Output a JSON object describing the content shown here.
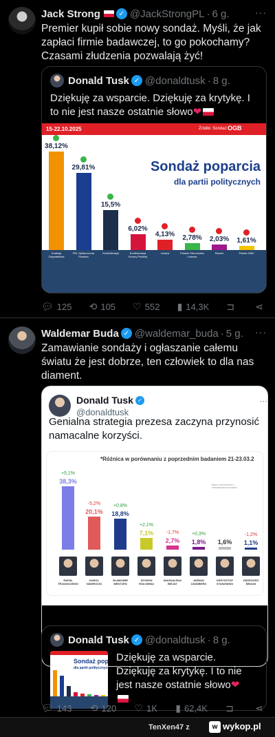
{
  "tweet1": {
    "name": "Jack Strong",
    "handle": "@JackStrongPL",
    "time": "6 g.",
    "more": "···",
    "text": "Premier kupił sobie nowy sondaż. Myśli, że jak zapłaci firmie badawczej, to go pokochamy? Czasami złudzenia pozwalają żyć!",
    "quote": {
      "name": "Donald Tusk",
      "handle": "@donaldtusk",
      "time": "8 g.",
      "text": "Dziękuję za wsparcie. Dziękuję za krytykę. I to nie jest nasze ostatnie słowo"
    },
    "actions": {
      "replies": "125",
      "reposts": "105",
      "likes": "552",
      "views": "14,3K"
    }
  },
  "poll1": {
    "date": "15-22.10.2025",
    "source": "Źródło: Sondaż",
    "brand": "OGB",
    "title": "Sondaż poparcia",
    "subtitle": "dla partii politycznych",
    "colors": {
      "header": "#e02027",
      "footer": "#27466d",
      "title": "#1b3f8b"
    }
  },
  "chart_data": [
    {
      "type": "bar",
      "title": "Sondaż poparcia",
      "subtitle": "dla partii politycznych",
      "categories": [
        "Koalicja Obywatelska",
        "PiS, Zjednoczona Prawica",
        "Konfederacja",
        "Konfederacja Korony Polskiej",
        "Lewica",
        "Polskie Stronnictwo Ludowe",
        "Razem",
        "Polska 2050"
      ],
      "values": [
        38.12,
        29.81,
        15.5,
        6.02,
        4.13,
        2.78,
        2.03,
        1.61
      ],
      "value_labels": [
        "38,12%",
        "29,81%",
        "15,5%",
        "6,02%",
        "4,13%",
        "2,78%",
        "2,03%",
        "1,61%"
      ],
      "colors": [
        "#f39200",
        "#1a3d8f",
        "#1c2e4a",
        "#d5143c",
        "#e02027",
        "#39b54a",
        "#a0178c",
        "#f4c400"
      ]
    },
    {
      "type": "bar",
      "title": "*Różnica w porównaniu z poprzednim badaniem 21-23.03.2",
      "categories": [
        "Rafał Trzaskowski",
        "Karol Nawrocki",
        "Sławomir Mentzen",
        "Szymon Hołownia",
        "Magdalena Biejat",
        "Adrian Zandberg",
        "Krzysztof Stanowski",
        "Grzegorz Braun"
      ],
      "values": [
        38.3,
        20.1,
        18.8,
        7.1,
        2.7,
        1.8,
        1.6,
        1.1
      ],
      "value_labels": [
        "38,3%",
        "20,1%",
        "18,8%",
        "7,1%",
        "2,7%",
        "1,8%",
        "1,6%",
        "1,1%"
      ],
      "changes": [
        "+5,1%",
        "-5,2%",
        "+0,8%",
        "+2,1%",
        "-1,7%",
        "+0,3%",
        "",
        "-1,2%"
      ],
      "colors": [
        "#7b7ee6",
        "#e05a5a",
        "#1f3c8c",
        "#c9c92a",
        "#d6348f",
        "#7a1a8c",
        "#bdbdbd",
        "#1f3c8c"
      ],
      "name_labels": [
        "RAFAŁ TRZASKOWSKI",
        "KAROL NAWROCKI",
        "SŁAWOMIR MENTZEN",
        "SZYMON HOŁOWNIA",
        "MAGDALENA BIEJAT",
        "ADRIAN ZANDBERG",
        "KRZYSZTOF STANOWSKI",
        "GRZEGORZ BRAUN"
      ]
    }
  ],
  "tweet2": {
    "name": "Waldemar Buda",
    "handle": "@waldemar_buda",
    "time": "5 g.",
    "more": "···",
    "text": "Zamawianie sondaży i ogłaszanie całemu światu że jest dobrze, ten człowiek to dla nas diament.",
    "quote": {
      "name": "Donald Tusk",
      "handle": "@donaldtusk",
      "more": "···",
      "text": "Genialna strategia prezesa zaczyna przynosić namacalne korzyści.",
      "small_note": "BRAK PORÓWNANIA Z POPRZEDNIM BADANIEM"
    },
    "inner_quote": {
      "name": "Donald Tusk",
      "handle": "@donaldtusk",
      "time": "8 g.",
      "text": "Dziękuję za wsparcie. Dziękuję za krytykę. I to nie jest nasze ostatnie słowo"
    },
    "actions": {
      "replies": "143",
      "reposts": "120",
      "likes": "1K",
      "views": "62,4K"
    }
  },
  "footer": {
    "user": "TenXen47",
    "sep": "z",
    "site": "wykop.pl",
    "logo": "w"
  }
}
